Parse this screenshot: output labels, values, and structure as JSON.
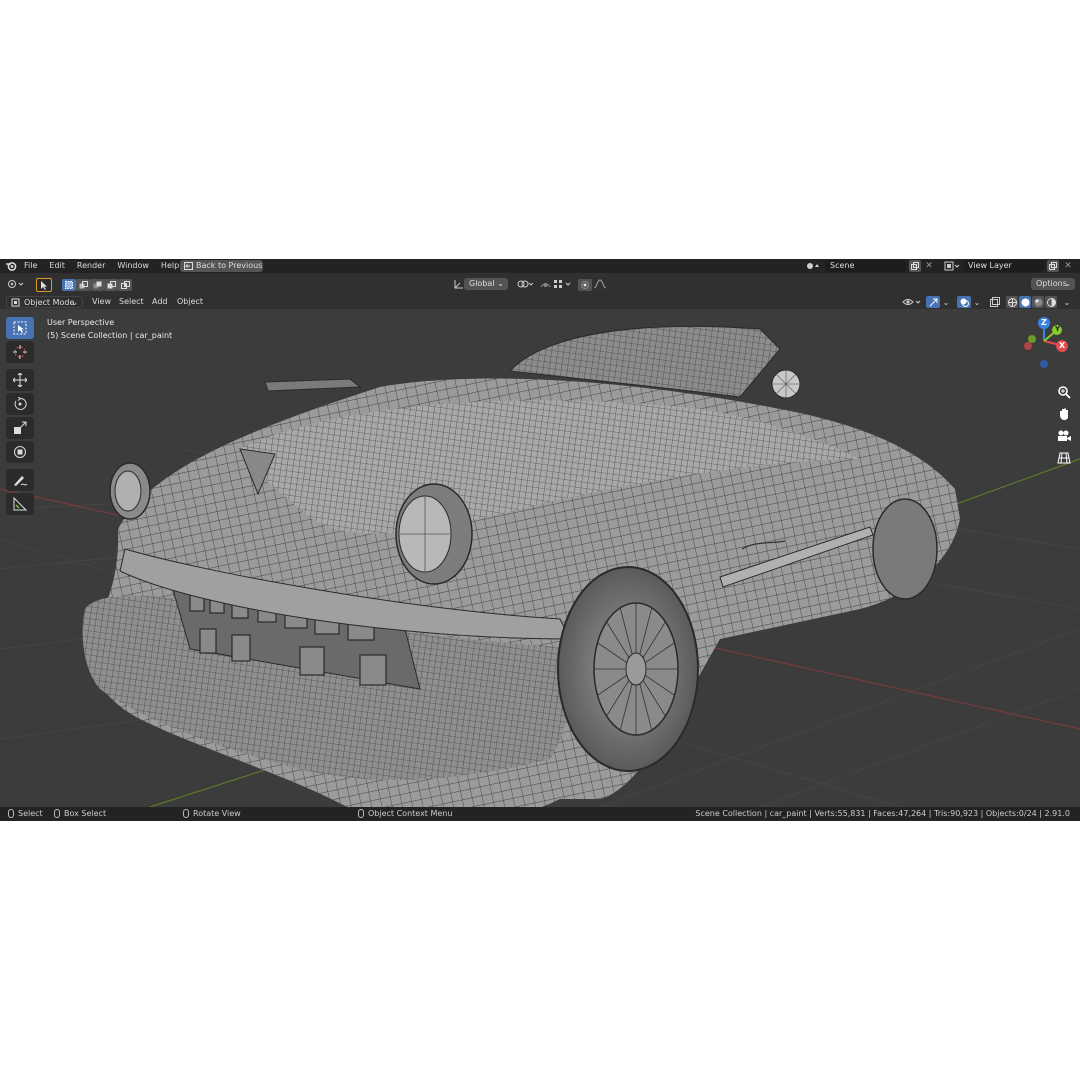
{
  "menu": [
    "File",
    "Edit",
    "Render",
    "Window",
    "Help"
  ],
  "back_button": "Back to Previous",
  "scene": {
    "value": "Scene"
  },
  "view_layer": {
    "value": "View Layer"
  },
  "toolbar": {
    "orientation": "Global",
    "options": "Options"
  },
  "header": {
    "mode": "Object Mode",
    "menus": [
      "View",
      "Select",
      "Add",
      "Object"
    ]
  },
  "viewport": {
    "perspective": "User Perspective",
    "collection": "(5) Scene Collection | car_paint"
  },
  "gizmo": {
    "x": "X",
    "y": "Y",
    "z": "Z"
  },
  "status": {
    "select": "Select",
    "box_select": "Box Select",
    "rotate_view": "Rotate View",
    "context_menu": "Object Context Menu",
    "stats": "Scene Collection | car_paint | Verts:55,831 | Faces:47,264 | Tris:90,923 | Objects:0/24 | 2.91.0"
  },
  "colors": {
    "accent": "#4772b3",
    "x_axis": "#e14c4c",
    "y_axis": "#8ac92b",
    "z_axis": "#3b82e0"
  },
  "icons": [
    "blender-logo-icon",
    "cursor-icon",
    "transform-icon",
    "search-icon",
    "hand-icon",
    "camera-icon",
    "grid-icon",
    "overlay-icon",
    "shading-icon"
  ]
}
